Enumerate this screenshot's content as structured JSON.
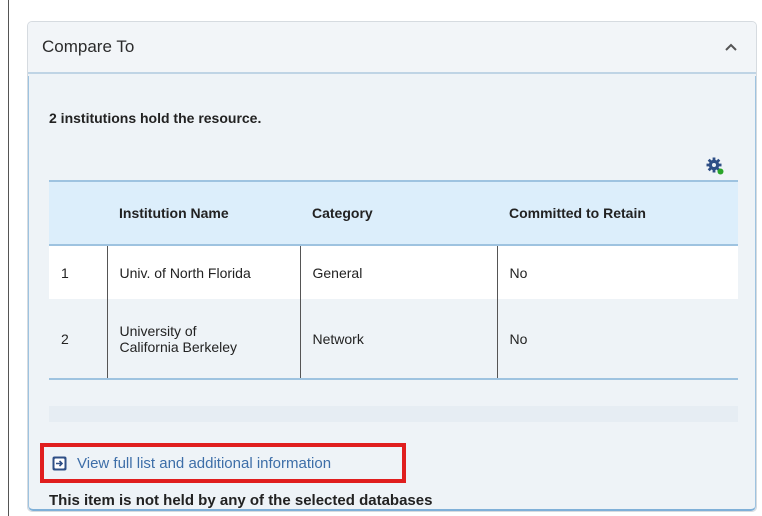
{
  "panel": {
    "title": "Compare To",
    "summary": "2 institutions hold the resource.",
    "icons": {
      "collapse": "chevron-up-icon",
      "settings": "gear-icon",
      "link": "open-panel-icon"
    },
    "colors": {
      "header_bg": "#dceefb",
      "accent_blue": "#3d6ea8",
      "gear_blue": "#2f4f86",
      "gear_dot_green": "#2aa52a",
      "highlight_red": "#e01e1e"
    }
  },
  "table": {
    "headers": [
      "",
      "Institution Name",
      "Category",
      "Committed to Retain"
    ],
    "rows": [
      {
        "num": "1",
        "name": "Univ. of North Florida",
        "category": "General",
        "retain": "No"
      },
      {
        "num": "2",
        "name_line1": "University of",
        "name_line2": "California Berkeley",
        "category": "Network",
        "retain": "No"
      }
    ]
  },
  "footer": {
    "link_label": "View full list and additional information",
    "note": "This item is not held by any of the selected databases"
  }
}
